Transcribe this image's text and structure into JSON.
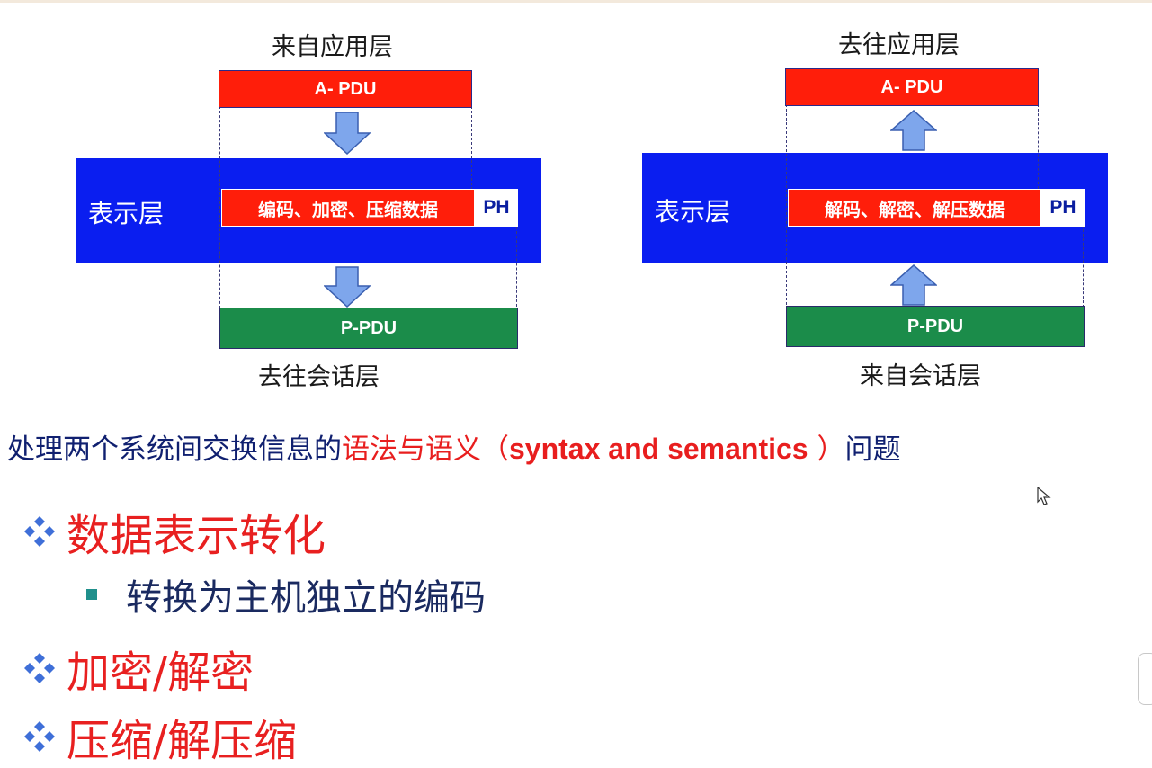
{
  "left_diagram": {
    "top_caption": "来自应用层",
    "a_pdu": "A- PDU",
    "layer_title": "表示层",
    "process": "编码、加密、压缩数据",
    "ph": "PH",
    "p_pdu": "P-PDU",
    "bottom_caption": "去往会话层",
    "arrow_direction": "down"
  },
  "right_diagram": {
    "top_caption": "去往应用层",
    "a_pdu": "A- PDU",
    "layer_title": "表示层",
    "process": "解码、解密、解压数据",
    "ph": "PH",
    "p_pdu": "P-PDU",
    "bottom_caption": "来自会话层",
    "arrow_direction": "up"
  },
  "summary": {
    "prefix": "处理两个系统间交换信息的",
    "highlight": "语法与语义（",
    "highlight_en": "syntax and semantics",
    "highlight_close": " ）",
    "suffix": "问题"
  },
  "bullets": [
    {
      "label": "数据表示转化",
      "sub": "转换为主机独立的编码"
    },
    {
      "label": "加密/解密"
    },
    {
      "label": "压缩/解压缩"
    }
  ],
  "colors": {
    "red": "#ff1e0a",
    "blue": "#0a1ef0",
    "green": "#1b8c4a",
    "arrow": "#7ea6ec"
  },
  "icons": [
    "diamond-bullet-icon",
    "square-bullet-icon",
    "mouse-cursor-icon",
    "arrow-down-icon",
    "arrow-up-icon"
  ]
}
